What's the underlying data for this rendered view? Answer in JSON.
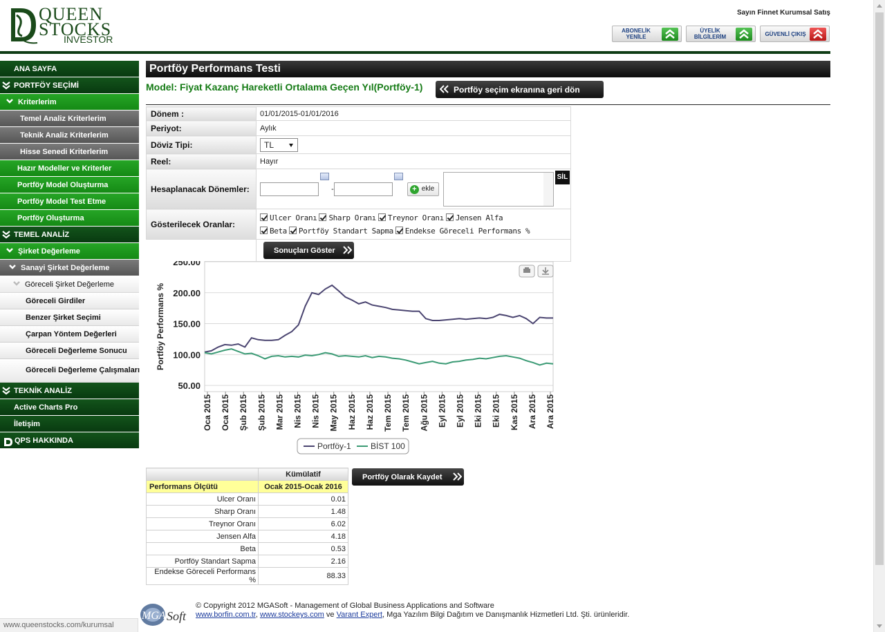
{
  "header": {
    "logo": {
      "line1": "QUEEN",
      "line2": "STOCKS",
      "line3": "INVESTOR"
    },
    "user": "Sayın Finnet Kurumsal Satış",
    "buttons": [
      {
        "line1": "ABONELİK",
        "line2": "YENİLE"
      },
      {
        "line1": "ÜYELİK",
        "line2": "BİLGİLERİM"
      },
      {
        "line1": "GÜVENLİ ÇIKIŞ",
        "line2": ""
      }
    ]
  },
  "sidebar": {
    "items": [
      {
        "label": "ANA SAYFA",
        "level": "lvl0",
        "chev": false
      },
      {
        "label": "PORTFÖY SEÇİMİ",
        "level": "lvl0",
        "chev": true
      },
      {
        "label": "Kriterlerim",
        "level": "lvl1",
        "chev": true
      },
      {
        "label": "Temel Analiz Kriterlerim",
        "level": "lvl2"
      },
      {
        "label": "Teknik Analiz Kriterlerim",
        "level": "lvl2"
      },
      {
        "label": "Hisse Senedi Kriterlerim",
        "level": "lvl2"
      },
      {
        "label": "Hazır Modeller ve Kriterler",
        "level": "lvl2g"
      },
      {
        "label": "Portföy Model Oluşturma",
        "level": "lvl2g"
      },
      {
        "label": "Portföy Model Test Etme",
        "level": "lvl2g"
      },
      {
        "label": "Portföy Oluşturma",
        "level": "lvl2g"
      },
      {
        "label": "TEMEL ANALİZ",
        "level": "lvl0",
        "chev": true
      },
      {
        "label": "Şirket Değerleme",
        "level": "lvl1",
        "chev": true
      },
      {
        "label": "Sanayi Şirket Değerleme",
        "level": "lvl3",
        "chev": true
      },
      {
        "label": "Göreceli Şirket Değerleme",
        "level": "lvl4",
        "chev": true
      },
      {
        "label": "Göreceli Girdiler",
        "level": "lvl5"
      },
      {
        "label": "Benzer Şirket Seçimi",
        "level": "lvl5"
      },
      {
        "label": "Çarpan Yöntem Değerleri",
        "level": "lvl5"
      },
      {
        "label": "Göreceli Değerleme Sonucu",
        "level": "lvl5"
      },
      {
        "label": "Göreceli Değerleme Çalışmaları",
        "level": "lvl5",
        "tall": true
      },
      {
        "label": "TEKNİK ANALİZ",
        "level": "lvl0",
        "chev": true
      },
      {
        "label": "Active Charts Pro",
        "level": "lvl0",
        "chev": false
      },
      {
        "label": "İletişim",
        "level": "lvl0",
        "chev": false
      },
      {
        "label": "QPS HAKKINDA",
        "level": "lvl0",
        "chev": false,
        "logo": true
      }
    ]
  },
  "main": {
    "title": "Portföy Performans Testi",
    "model": "Model: Fiyat Kazanç Hareketli Ortalama Geçen Yıl(Portföy-1)",
    "back_button": "Portföy seçim ekranına geri dön",
    "form": {
      "donem_label": "Dönem :",
      "donem_value": "01/01/2015-01/01/2016",
      "periyot_label": "Periyot:",
      "periyot_value": "Aylık",
      "doviz_label": "Döviz Tipi:",
      "doviz_value": "TL",
      "reel_label": "Reel:",
      "reel_value": "Hayır",
      "hesap_label": "Hesaplanacak Dönemler:",
      "range_sep": "-",
      "ekle": "ekle",
      "sil": "SİL",
      "oranlar_label": "Gösterilecek Oranlar:",
      "checks_row1": [
        "Ulcer Oranı",
        "Sharp Oranı",
        "Treynor Oranı",
        "Jensen Alfa"
      ],
      "checks_row2": [
        "Beta",
        "Portföy Standart Sapma",
        "Endekse Göreceli Performans %"
      ],
      "show_button": "Sonuçları Göster"
    },
    "save_button": "Portföy Olarak Kaydet",
    "results": {
      "col_header": "Kümülatif",
      "row_header": "Performans Ölçütü",
      "period": "Ocak 2015-Ocak 2016",
      "rows": [
        {
          "name": "Ulcer Oranı",
          "value": "0.01"
        },
        {
          "name": "Sharp Oranı",
          "value": "1.48"
        },
        {
          "name": "Treynor Oranı",
          "value": "6.02"
        },
        {
          "name": "Jensen Alfa",
          "value": "4.18"
        },
        {
          "name": "Beta",
          "value": "0.53"
        },
        {
          "name": "Portföy Standart Sapma",
          "value": "2.16"
        },
        {
          "name": "Endekse Göreceli Performans %",
          "value": "88.33"
        }
      ]
    }
  },
  "chart_data": {
    "type": "line",
    "title": "",
    "ylabel": "Portföy Performans %",
    "xlabel": "",
    "ylim": [
      50,
      250
    ],
    "yticks": [
      "250.00",
      "200.00",
      "150.00",
      "100.00",
      "50.00"
    ],
    "x_tick_labels": [
      "Oca 2015",
      "Oca 2015",
      "Şub 2015",
      "Şub 2015",
      "Mar 2015",
      "Nis 2015",
      "Nis 2015",
      "May 2015",
      "Haz 2015",
      "Haz 2015",
      "Tem 2015",
      "Tem 2015",
      "Ağu 2015",
      "Eyl 2015",
      "Eyl 2015",
      "Eki 2015",
      "Eki 2015",
      "Kas 2015",
      "Ara 2015",
      "Ara 2015"
    ],
    "grid": true,
    "legend": "bottom",
    "colors": {
      "Portföy-1": "#4a4470",
      "BİST 100": "#3a9a74"
    },
    "series": [
      {
        "name": "Portföy-1",
        "values": [
          104,
          106,
          112,
          116,
          115,
          117,
          112,
          127,
          124,
          123,
          123,
          124,
          131,
          137,
          148,
          178,
          200,
          197,
          206,
          212,
          203,
          193,
          188,
          182,
          185,
          180,
          178,
          176,
          173,
          172,
          171,
          170,
          170,
          158,
          155,
          155,
          156,
          157,
          158,
          157,
          158,
          159,
          158,
          160,
          165,
          163,
          160,
          163,
          158,
          150,
          160,
          159,
          159
        ]
      },
      {
        "name": "BİST 100",
        "values": [
          103,
          101,
          104,
          107,
          109,
          105,
          101,
          102,
          98,
          93,
          97,
          98,
          96,
          97,
          96,
          99,
          98,
          100,
          103,
          101,
          97,
          98,
          97,
          96,
          98,
          95,
          97,
          96,
          94,
          93,
          91,
          88,
          85,
          87,
          89,
          86,
          85,
          88,
          89,
          91,
          92,
          94,
          93,
          95,
          97,
          98,
          96,
          94,
          90,
          87,
          83,
          86,
          85
        ]
      }
    ]
  },
  "footer": {
    "line1": "© Copyright 2012 MGASoft - Management of Global Business Applications and Software",
    "link1": "www.borfin.com.tr",
    "sep1": ", ",
    "link2": "www.stockeys.com",
    "and": " ve ",
    "link3": "Varant Expert",
    "tail": ", Mga Yazılım Bilgi Dağıtım ve Danışmanlık Hizmetleri Ltd. Şti. ürünleridir.",
    "logo_text": "MGASoft"
  },
  "status_url": "www.queenstocks.com/kurumsal"
}
